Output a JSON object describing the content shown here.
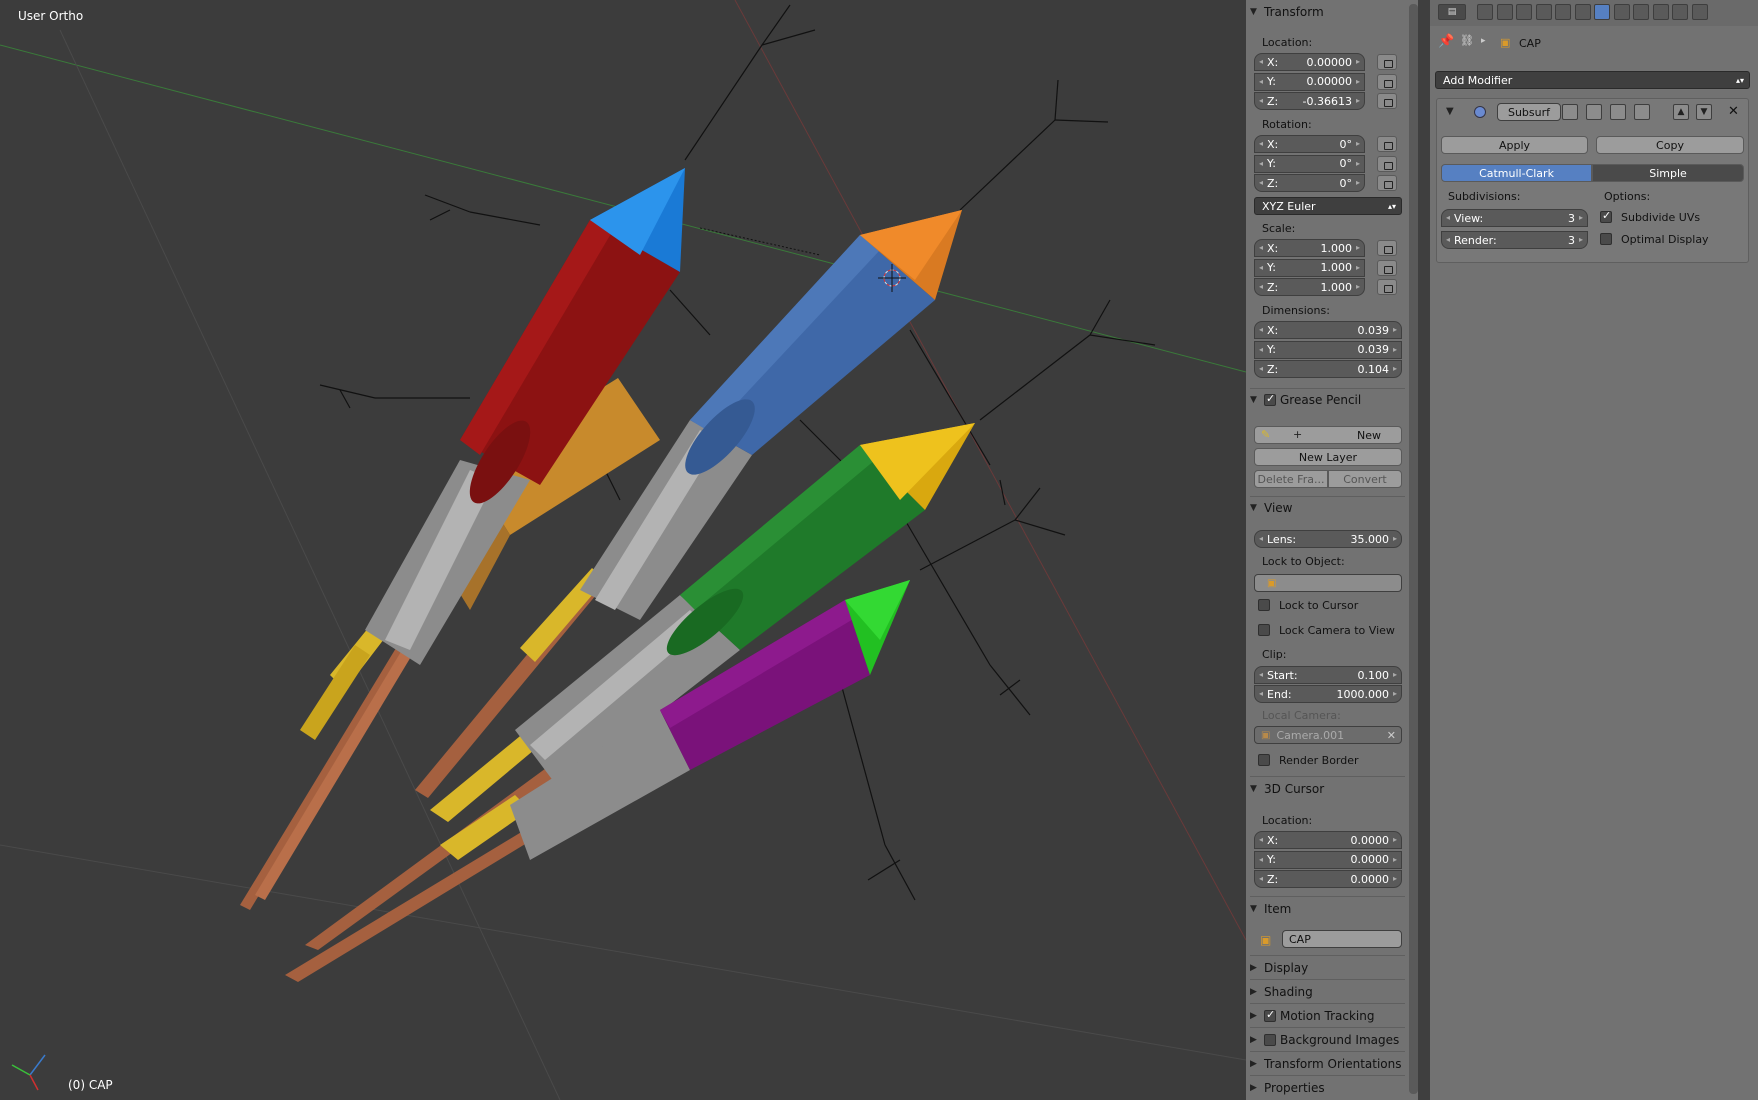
{
  "viewport": {
    "view_label": "User Ortho",
    "object_label": "(0) CAP"
  },
  "npanel": {
    "transform": {
      "title": "Transform",
      "location_label": "Location:",
      "location": [
        {
          "axis": "X:",
          "value": "0.00000"
        },
        {
          "axis": "Y:",
          "value": "0.00000"
        },
        {
          "axis": "Z:",
          "value": "-0.36613"
        }
      ],
      "rotation_label": "Rotation:",
      "rotation": [
        {
          "axis": "X:",
          "value": "0°"
        },
        {
          "axis": "Y:",
          "value": "0°"
        },
        {
          "axis": "Z:",
          "value": "0°"
        }
      ],
      "rotation_mode": "XYZ Euler",
      "scale_label": "Scale:",
      "scale": [
        {
          "axis": "X:",
          "value": "1.000"
        },
        {
          "axis": "Y:",
          "value": "1.000"
        },
        {
          "axis": "Z:",
          "value": "1.000"
        }
      ],
      "dimensions_label": "Dimensions:",
      "dimensions": [
        {
          "axis": "X:",
          "value": "0.039"
        },
        {
          "axis": "Y:",
          "value": "0.039"
        },
        {
          "axis": "Z:",
          "value": "0.104"
        }
      ]
    },
    "grease_pencil": {
      "title": "Grease Pencil",
      "new_label": "New",
      "new_layer_label": "New Layer",
      "delete_frame_label": "Delete Fra...",
      "convert_label": "Convert"
    },
    "view": {
      "title": "View",
      "lens_label": "Lens:",
      "lens_value": "35.000",
      "lock_to_object_label": "Lock to Object:",
      "lock_to_cursor_label": "Lock to Cursor",
      "lock_camera_label": "Lock Camera to View",
      "clip_label": "Clip:",
      "clip_start_label": "Start:",
      "clip_start_value": "0.100",
      "clip_end_label": "End:",
      "clip_end_value": "1000.000",
      "local_camera_label": "Local Camera:",
      "local_camera_value": "Camera.001",
      "render_border_label": "Render Border"
    },
    "cursor": {
      "title": "3D Cursor",
      "location_label": "Location:",
      "location": [
        {
          "axis": "X:",
          "value": "0.0000"
        },
        {
          "axis": "Y:",
          "value": "0.0000"
        },
        {
          "axis": "Z:",
          "value": "0.0000"
        }
      ]
    },
    "item": {
      "title": "Item",
      "name": "CAP"
    },
    "collapsed": [
      {
        "label": "Display",
        "checkbox": false
      },
      {
        "label": "Shading",
        "checkbox": false
      },
      {
        "label": "Motion Tracking",
        "checkbox": true,
        "checked": true
      },
      {
        "label": "Background Images",
        "checkbox": true,
        "checked": false
      },
      {
        "label": "Transform Orientations",
        "checkbox": false
      },
      {
        "label": "Properties",
        "checkbox": false
      }
    ]
  },
  "properties": {
    "breadcrumb_object": "CAP",
    "add_modifier_label": "Add Modifier",
    "modifier": {
      "name": "Subsurf",
      "apply_label": "Apply",
      "copy_label": "Copy",
      "mode_catmull": "Catmull-Clark",
      "mode_simple": "Simple",
      "subdivisions_label": "Subdivisions:",
      "view_label": "View:",
      "view_value": "3",
      "render_label": "Render:",
      "render_value": "3",
      "options_label": "Options:",
      "subdivide_uvs_label": "Subdivide UVs",
      "optimal_display_label": "Optimal Display"
    }
  },
  "colors": {
    "accent": "#5680c2",
    "panel_bg": "#727272",
    "viewport_bg": "#3c3c3c"
  }
}
